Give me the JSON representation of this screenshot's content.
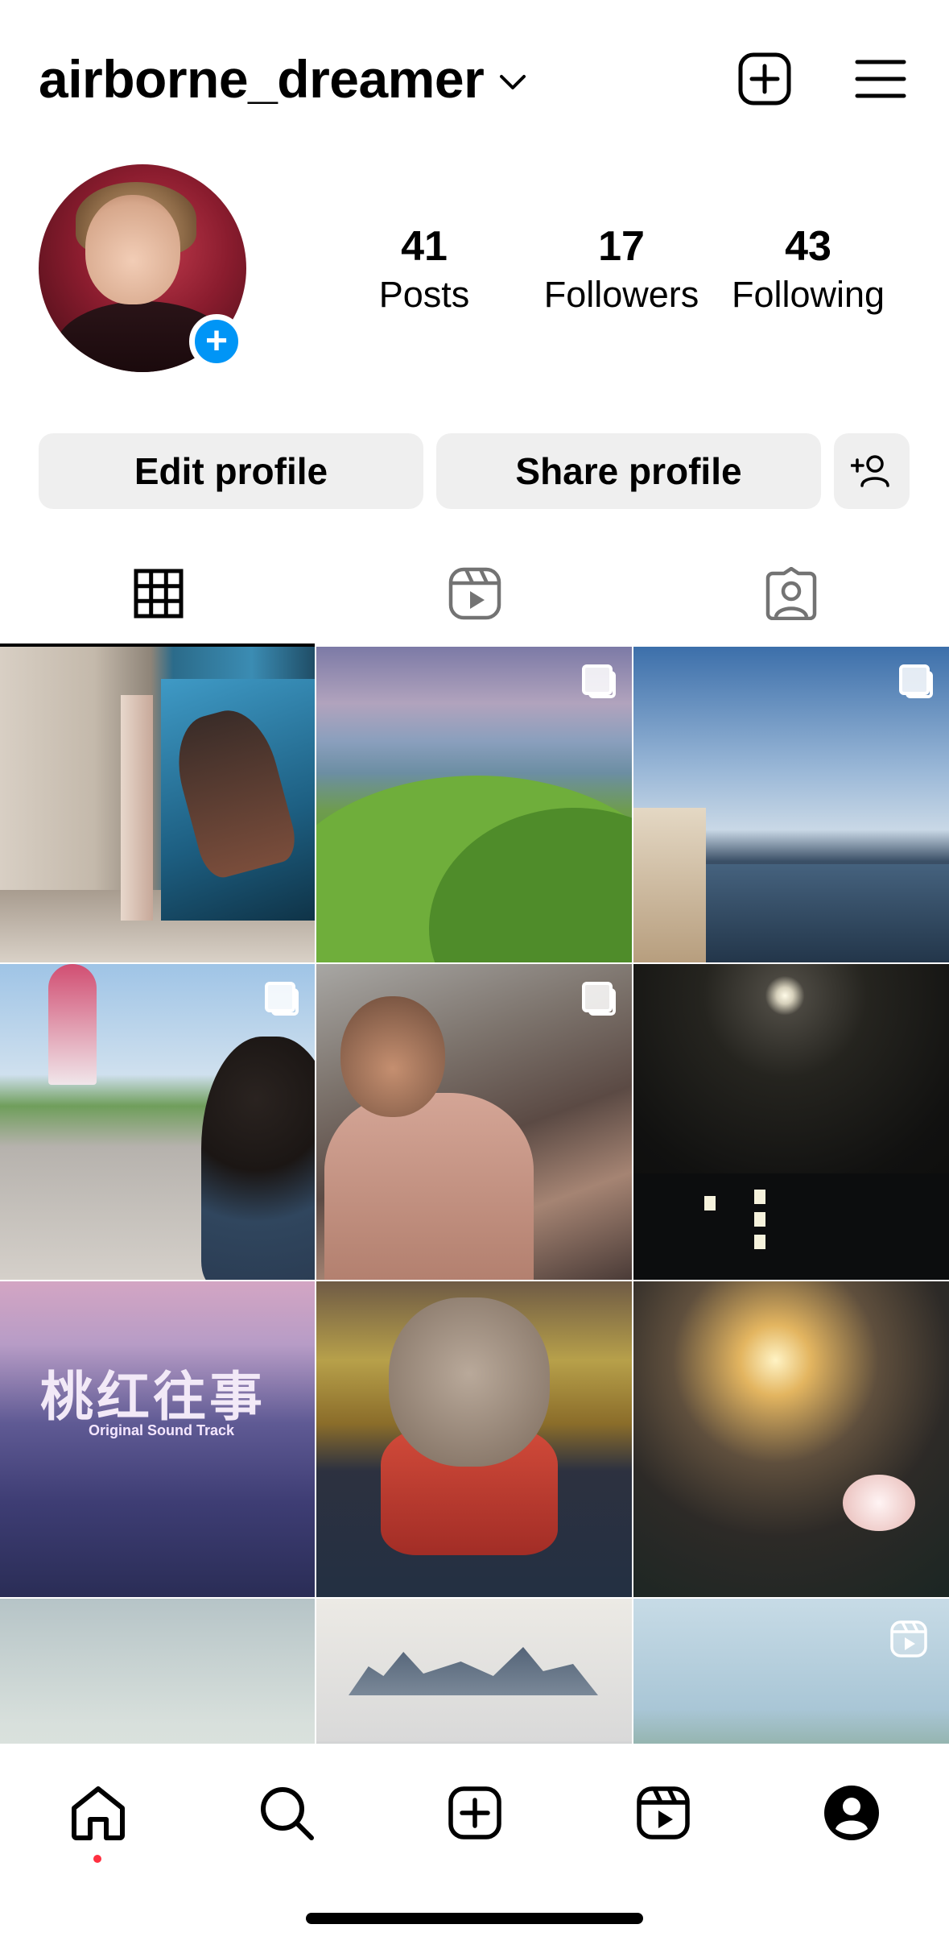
{
  "header": {
    "username": "airborne_dreamer",
    "icons": [
      "chevron-down-icon",
      "new-post-icon",
      "menu-icon"
    ]
  },
  "profile": {
    "stats": [
      {
        "value": "41",
        "label": "Posts"
      },
      {
        "value": "17",
        "label": "Followers"
      },
      {
        "value": "43",
        "label": "Following"
      }
    ]
  },
  "actions": {
    "edit_label": "Edit profile",
    "share_label": "Share profile"
  },
  "tabs": [
    {
      "name": "posts-grid",
      "icon": "grid-icon",
      "active": true
    },
    {
      "name": "reels",
      "icon": "reels-icon",
      "active": false
    },
    {
      "name": "tagged",
      "icon": "tagged-icon",
      "active": false
    }
  ],
  "grid": {
    "posts": [
      {
        "type": "photo"
      },
      {
        "type": "carousel"
      },
      {
        "type": "carousel"
      },
      {
        "type": "carousel"
      },
      {
        "type": "carousel"
      },
      {
        "type": "photo"
      },
      {
        "type": "photo",
        "overlay_text": "桃红往事",
        "overlay_sub": "Original Sound Track"
      },
      {
        "type": "photo"
      },
      {
        "type": "photo"
      },
      {
        "type": "photo"
      },
      {
        "type": "photo"
      },
      {
        "type": "reel"
      }
    ]
  },
  "bottom_nav": {
    "items": [
      "home-icon",
      "search-icon",
      "create-icon",
      "reels-icon",
      "profile-icon"
    ],
    "active": "home-icon",
    "notification_color": "#ff3040"
  },
  "colors": {
    "accent": "#0095f6",
    "button_bg": "#efefef"
  }
}
